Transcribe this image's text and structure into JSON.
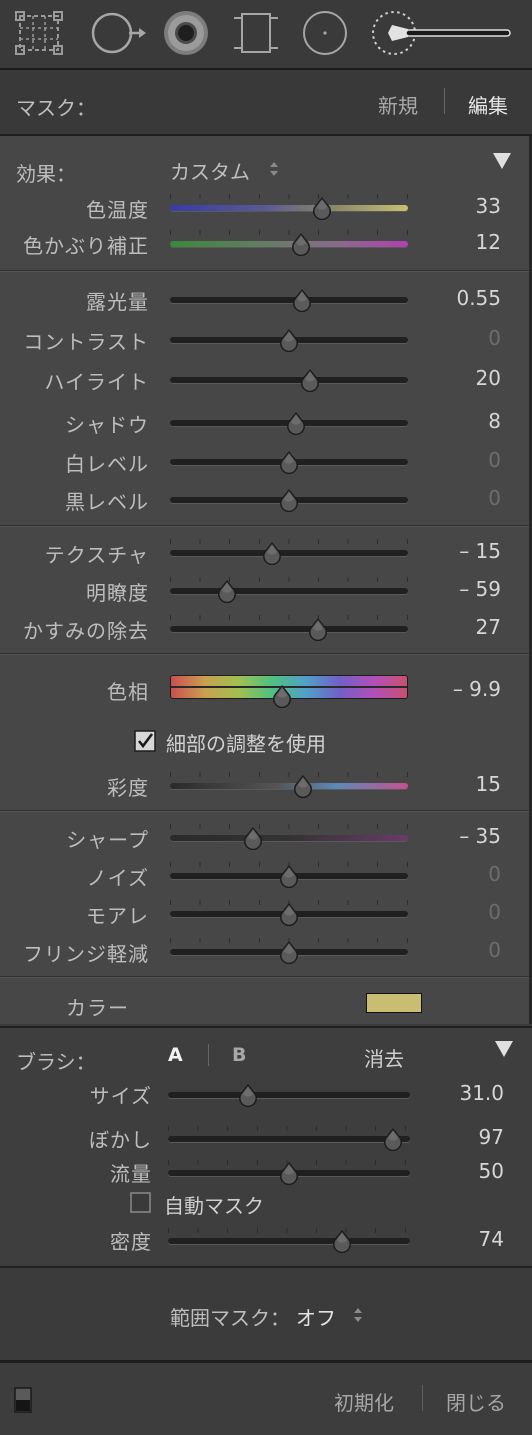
{
  "mask": {
    "label": "マスク：",
    "new_label": "新規",
    "edit_label": "編集"
  },
  "effect": {
    "label": "効果：",
    "preset": "カスタム"
  },
  "sliders": {
    "temp": {
      "label": "色温度",
      "value": "33",
      "pos": 0.64
    },
    "tint": {
      "label": "色かぶり補正",
      "value": "12",
      "pos": 0.55
    },
    "exposure": {
      "label": "露光量",
      "value": "0.55",
      "pos": 0.555
    },
    "contrast": {
      "label": "コントラスト",
      "value": "0",
      "pos": 0.5
    },
    "highlights": {
      "label": "ハイライト",
      "value": "20",
      "pos": 0.59
    },
    "shadows": {
      "label": "シャドウ",
      "value": "8",
      "pos": 0.53
    },
    "whites": {
      "label": "白レベル",
      "value": "0",
      "pos": 0.5
    },
    "blacks": {
      "label": "黒レベル",
      "value": "0",
      "pos": 0.5
    },
    "texture": {
      "label": "テクスチャ",
      "value": "– 15",
      "pos": 0.43
    },
    "clarity": {
      "label": "明瞭度",
      "value": "– 59",
      "pos": 0.24
    },
    "dehaze": {
      "label": "かすみの除去",
      "value": "27",
      "pos": 0.62
    },
    "saturation": {
      "label": "彩度",
      "value": "15",
      "pos": 0.56
    },
    "sharpness": {
      "label": "シャープ",
      "value": "– 35",
      "pos": 0.35
    },
    "noise": {
      "label": "ノイズ",
      "value": "0",
      "pos": 0.5
    },
    "moire": {
      "label": "モアレ",
      "value": "0",
      "pos": 0.5
    },
    "defringe": {
      "label": "フリンジ軽減",
      "value": "0",
      "pos": 0.5
    }
  },
  "hue": {
    "label": "色相",
    "value": "– 9.9",
    "pos": 0.47
  },
  "fine_adjust": {
    "label": "細部の調整を使用",
    "checked": true
  },
  "color": {
    "label": "カラー",
    "swatch": "#c9bd73"
  },
  "brush": {
    "label": "ブラシ：",
    "a_label": "A",
    "b_label": "B",
    "erase_label": "消去",
    "size": {
      "label": "サイズ",
      "value": "31.0",
      "pos": 0.33
    },
    "feather": {
      "label": "ぼかし",
      "value": "97",
      "pos": 0.93
    },
    "flow": {
      "label": "流量",
      "value": "50",
      "pos": 0.5
    },
    "auto_mask": {
      "label": "自動マスク",
      "checked": false
    },
    "density": {
      "label": "密度",
      "value": "74",
      "pos": 0.72
    }
  },
  "range_mask": {
    "label": "範囲マスク：",
    "value": "オフ"
  },
  "footer": {
    "reset_label": "初期化",
    "close_label": "閉じる"
  }
}
